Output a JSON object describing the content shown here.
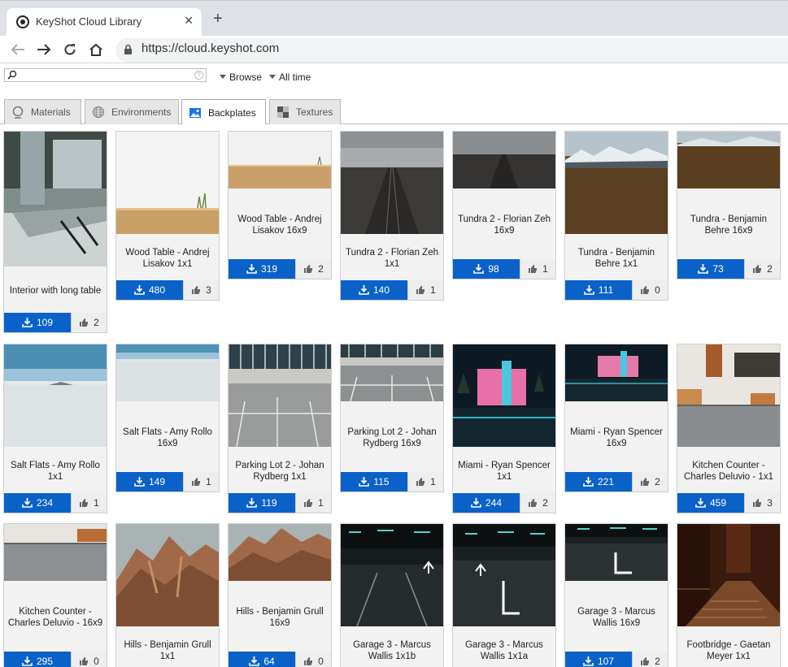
{
  "browser": {
    "tab_title": "KeyShot Cloud Library",
    "new_tab_label": "+",
    "close_label": "✕",
    "url": "https://cloud.keyshot.com"
  },
  "search": {
    "placeholder": "",
    "help_label": "?"
  },
  "filters": {
    "browse_label": "Browse",
    "time_label": "All time"
  },
  "category_tabs": [
    {
      "label": "Materials",
      "icon": "sphere-icon"
    },
    {
      "label": "Environments",
      "icon": "globe-icon"
    },
    {
      "label": "Backplates",
      "icon": "image-icon",
      "active": true
    },
    {
      "label": "Textures",
      "icon": "checker-icon"
    }
  ],
  "cards": [
    {
      "title": "Interior with long table",
      "downloads": "109",
      "likes": "2"
    },
    {
      "title": "Wood Table - Andrej Lisakov 1x1",
      "downloads": "480",
      "likes": "3"
    },
    {
      "title": "Wood Table - Andrej Lisakov 16x9",
      "downloads": "319",
      "likes": "2"
    },
    {
      "title": "Tundra 2 - Florian Zeh 1x1",
      "downloads": "140",
      "likes": "1"
    },
    {
      "title": "Tundra 2 - Florian Zeh 16x9",
      "downloads": "98",
      "likes": "1"
    },
    {
      "title": "Tundra - Benjamin Behre 1x1",
      "downloads": "111",
      "likes": "0"
    },
    {
      "title": "Tundra - Benjamin Behre 16x9",
      "downloads": "73",
      "likes": "2"
    },
    {
      "title": "Salt Flats - Amy Rollo 1x1",
      "downloads": "234",
      "likes": "1"
    },
    {
      "title": "Salt Flats - Amy Rollo 16x9",
      "downloads": "149",
      "likes": "1"
    },
    {
      "title": "Parking Lot 2 - Johan Rydberg 1x1",
      "downloads": "119",
      "likes": "1"
    },
    {
      "title": "Parking Lot 2 - Johan Rydberg 16x9",
      "downloads": "115",
      "likes": "1"
    },
    {
      "title": "Miami - Ryan Spencer 1x1",
      "downloads": "244",
      "likes": "2"
    },
    {
      "title": "Miami - Ryan Spencer 16x9",
      "downloads": "221",
      "likes": "2"
    },
    {
      "title": "Kitchen Counter - Charles Deluvio - 1x1",
      "downloads": "459",
      "likes": "3"
    },
    {
      "title": "Kitchen Counter - Charles Deluvio - 16x9",
      "downloads": "295",
      "likes": "0"
    },
    {
      "title": "Hills - Benjamin Grull 1x1",
      "downloads": "",
      "likes": ""
    },
    {
      "title": "Hills - Benjamin Grull 16x9",
      "downloads": "64",
      "likes": "0"
    },
    {
      "title": "Garage 3 - Marcus Wallis 1x1b",
      "downloads": "",
      "likes": ""
    },
    {
      "title": "Garage 3 - Marcus Wallis 1x1a",
      "downloads": "",
      "likes": ""
    },
    {
      "title": "Garage 3 - Marcus Wallis 16x9",
      "downloads": "107",
      "likes": "2"
    },
    {
      "title": "Footbridge - Gaetan Meyer 1x1",
      "downloads": "",
      "likes": ""
    }
  ],
  "colors": {
    "download_button": "#0a62c9",
    "card_bg": "#f2f2f2"
  }
}
